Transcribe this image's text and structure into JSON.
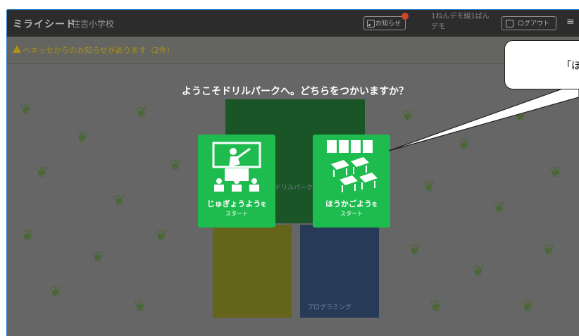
{
  "header": {
    "logo": "ミライシード",
    "school": "住吉小学校",
    "news_label": "お知らせ",
    "news_badge": "",
    "user_line1": "1ねんデモ組1ばん",
    "user_line2": "デモ",
    "logout_label": "ログアウト",
    "menu_icon": "≡"
  },
  "notice": {
    "text": "ベネッセからのお知らせがあります（2件）"
  },
  "background": {
    "tiles": [
      "",
      "ドリルパーク",
      "",
      "プログラミング"
    ]
  },
  "modal": {
    "prompt": "ようこそドリルパークへ。どちらをつかいますか？",
    "choices": [
      {
        "title": "じゅぎょうよう",
        "suffix": "を",
        "sub": "スタート"
      },
      {
        "title": "ほうかごよう",
        "suffix": "を",
        "sub": "スタート"
      }
    ]
  },
  "callout": {
    "text": "「ほ"
  },
  "colors": {
    "header_bg": "#2f2f2f",
    "choice_green": "#1ebc4f",
    "page_dim": "#6c6c6c",
    "accent_border": "#2b7fd1"
  }
}
